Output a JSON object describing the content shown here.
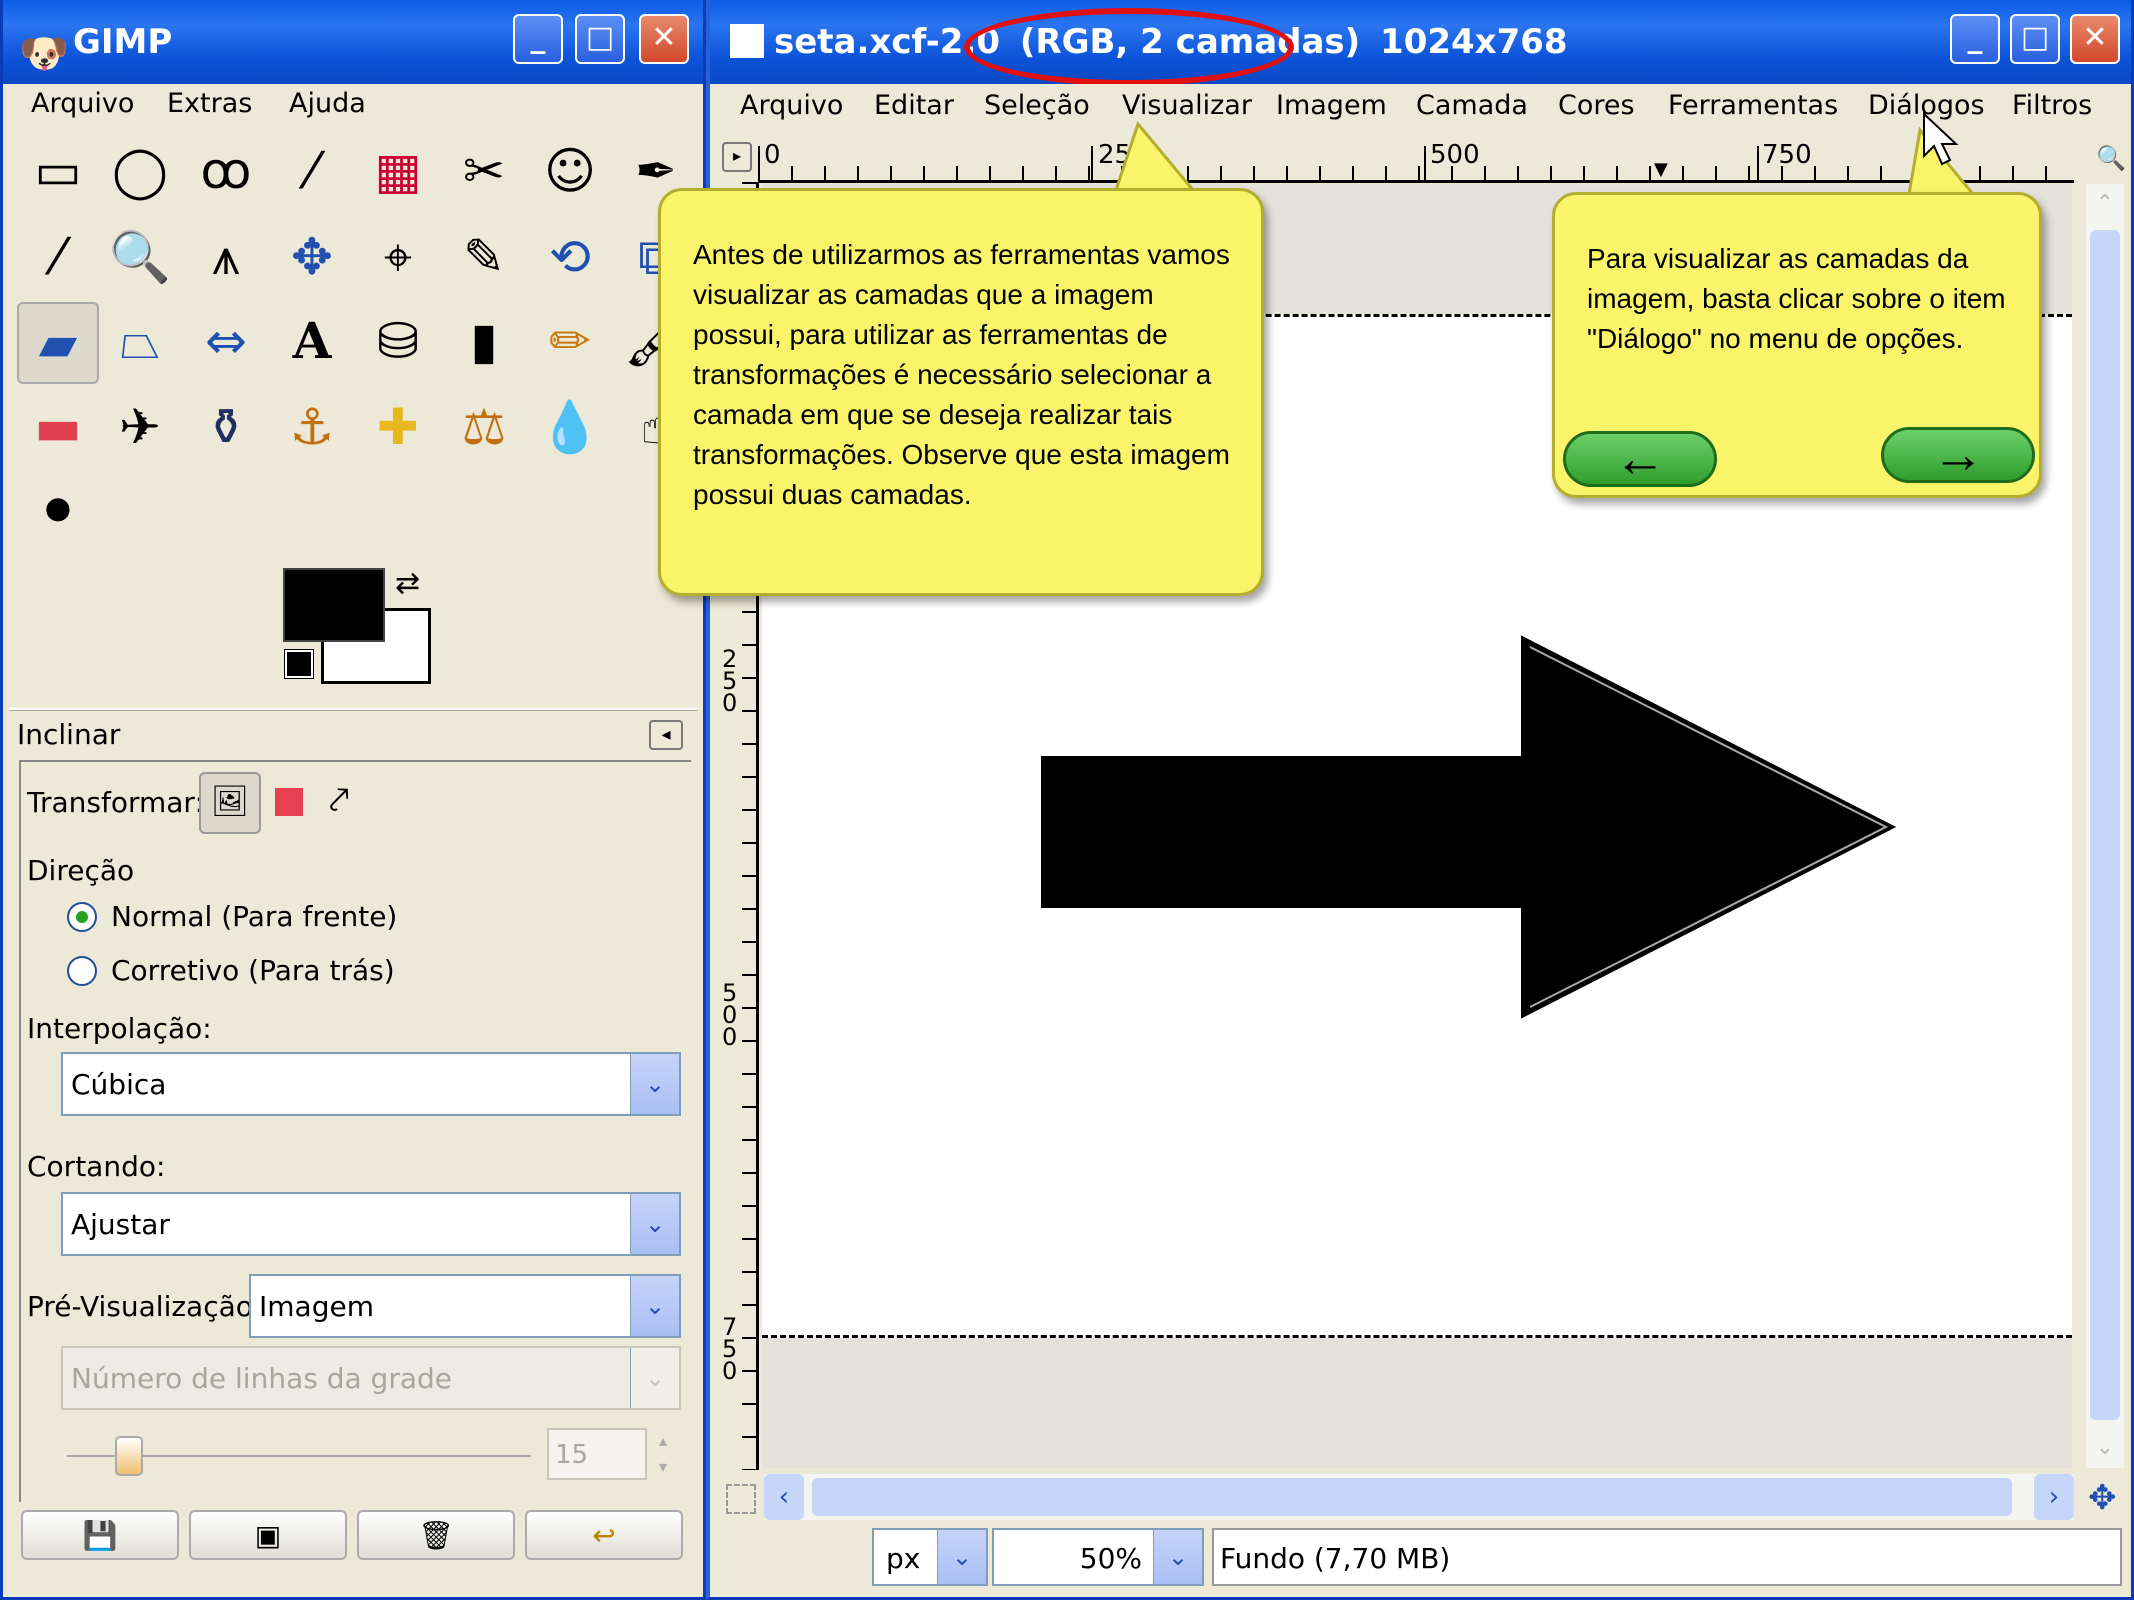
{
  "toolbox": {
    "title": "GIMP",
    "menu": [
      "Arquivo",
      "Extras",
      "Ajuda"
    ],
    "tool_icons": [
      "rect-select-icon",
      "ellipse-select-icon",
      "lasso-icon",
      "fuzzy-select-icon",
      "color-select-icon",
      "scissors-icon",
      "foreground-select-icon",
      "paths-icon",
      "color-picker-icon",
      "zoom-icon",
      "measure-icon",
      "move-icon",
      "align-icon",
      "crop-icon",
      "rotate-icon",
      "scale-icon",
      "shear-icon",
      "perspective-icon",
      "flip-icon",
      "text-icon",
      "bucket-fill-icon",
      "blend-icon",
      "pencil-icon",
      "paintbrush-icon",
      "eraser-icon",
      "airbrush-icon",
      "ink-icon",
      "clone-icon",
      "heal-icon",
      "perspective-clone-icon",
      "blur-icon",
      "smudge-icon",
      "dodge-icon"
    ]
  },
  "tool_options": {
    "title": "Inclinar",
    "transform_label": "Transformar:",
    "direction_label": "Direção",
    "direction_normal": "Normal (Para frente)",
    "direction_corrective": "Corretivo (Para trás)",
    "interpolation_label": "Interpolação:",
    "interpolation_value": "Cúbica",
    "clipping_label": "Cortando:",
    "clipping_value": "Ajustar",
    "preview_label": "Pré-Visualização:",
    "preview_value": "Imagem",
    "grid_lines_placeholder": "Número de linhas da grade",
    "grid_lines_value": "15"
  },
  "image_window": {
    "title_prefix": "seta.xcf-2.0",
    "title_highlight": "(RGB, 2 camadas)",
    "title_suffix": "1024x768",
    "menu": [
      "Arquivo",
      "Editar",
      "Seleção",
      "Visualizar",
      "Imagem",
      "Camada",
      "Cores",
      "Ferramentas",
      "Diálogos",
      "Filtros"
    ],
    "ruler_h": [
      "0",
      "250",
      "500",
      "750"
    ],
    "ruler_v": [
      "250",
      "500",
      "750"
    ],
    "unit": "px",
    "zoom": "50%",
    "status": "Fundo (7,70 MB)"
  },
  "tutorial": {
    "bubble1": "Antes de utilizarmos as ferramentas vamos visualizar as camadas que a imagem possui, para utilizar as ferramentas de transformações é necessário selecionar a camada em que se deseja realizar tais transformações. Observe que esta imagem possui duas camadas.",
    "bubble2": "Para visualizar as camadas da imagem, basta clicar sobre o item \"Diálogo\" no menu de opções.",
    "back_arrow": "←",
    "next_arrow": "→"
  },
  "colors": {
    "title_bar": "#0b5de7",
    "bubble_fill": "#f9f46a",
    "nav_button": "#4cb84a",
    "highlight_ring": "#e01010"
  }
}
